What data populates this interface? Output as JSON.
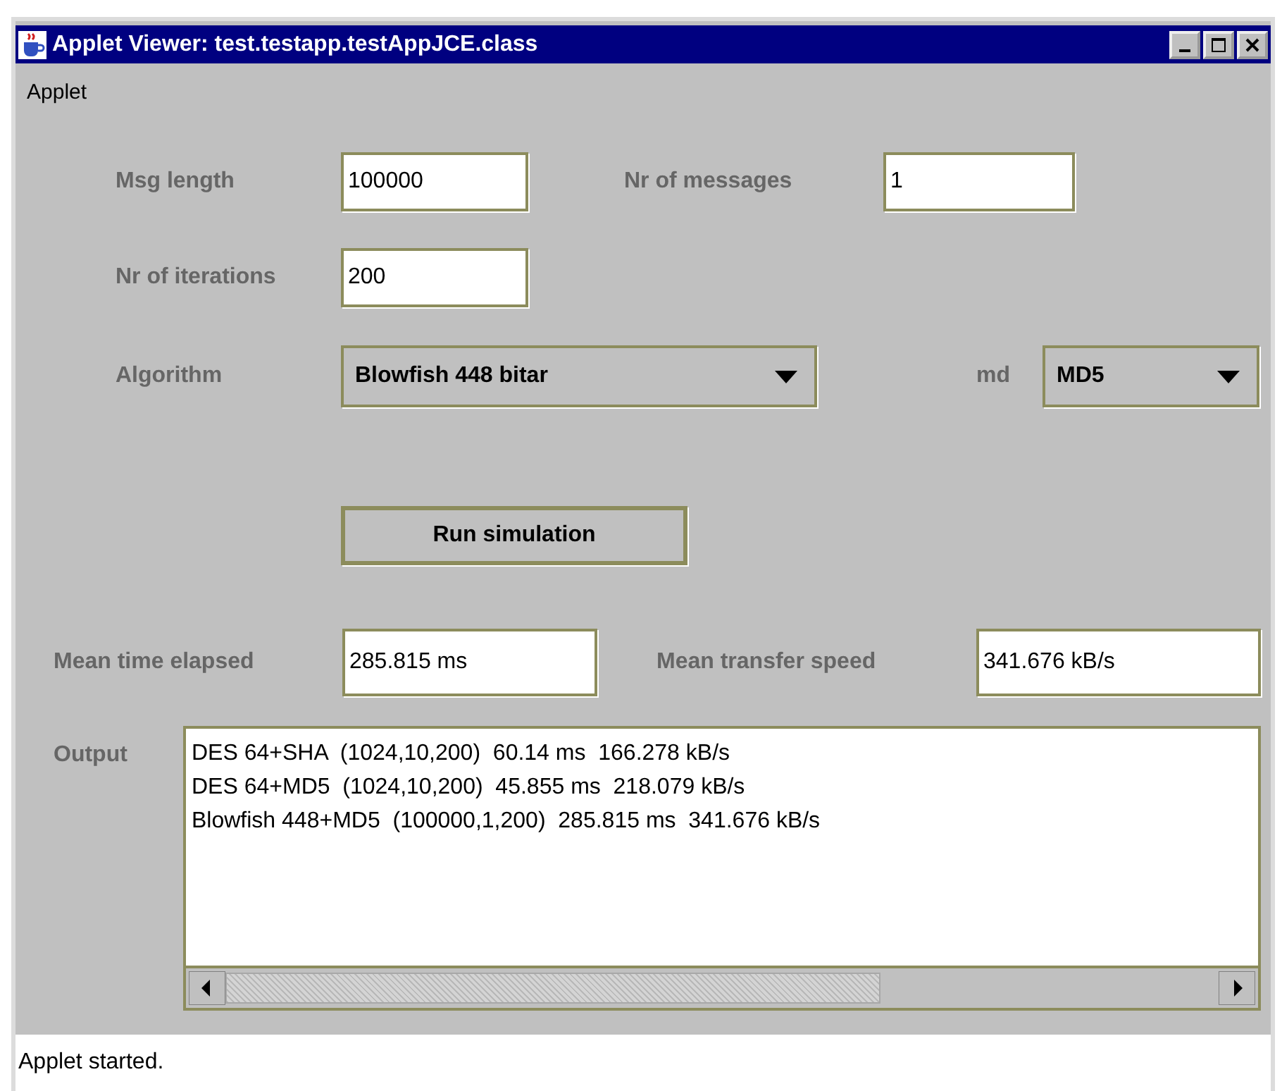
{
  "window": {
    "title": "Applet Viewer: test.testapp.testAppJCE.class"
  },
  "menu": [
    "Applet"
  ],
  "inputs": [
    {
      "label": "Msg length",
      "value": "100000"
    },
    {
      "label": "Nr of messages",
      "value": "1"
    },
    {
      "label": "Nr of iterations",
      "value": "200"
    }
  ],
  "dropdowns": [
    {
      "label": "Algorithm",
      "value": "Blowfish 448 bitar"
    },
    {
      "label": "md",
      "value": "MD5"
    }
  ],
  "button": "Run simulation",
  "results": [
    {
      "label": "Mean time elapsed",
      "value": "285.815 ms"
    },
    {
      "label": "Mean transfer speed",
      "value": "341.676 kB/s"
    }
  ],
  "output": {
    "label": "Output",
    "lines": [
      "DES 64+SHA  (1024,10,200)  60.14 ms  166.278 kB/s",
      "DES 64+MD5  (1024,10,200)  45.855 ms  218.079 kB/s",
      "Blowfish 448+MD5  (100000,1,200)  285.815 ms  341.676 kB/s"
    ]
  },
  "status_bar": "Applet started."
}
